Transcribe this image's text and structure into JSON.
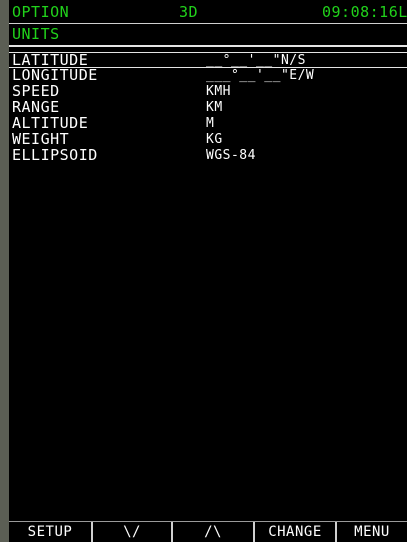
{
  "header": {
    "title": "OPTION",
    "mode": "3D",
    "time": "09:08:16L"
  },
  "page": {
    "title": "UNITS"
  },
  "rows": [
    {
      "label": "LATITUDE",
      "value": "__°__'__\"N/S"
    },
    {
      "label": "LONGITUDE",
      "value": "___°__'__\"E/W"
    },
    {
      "label": "SPEED",
      "value": "KMH"
    },
    {
      "label": "RANGE",
      "value": "KM"
    },
    {
      "label": "ALTITUDE",
      "value": "M"
    },
    {
      "label": "WEIGHT",
      "value": "KG"
    },
    {
      "label": "ELLIPSOID",
      "value": "WGS-84"
    }
  ],
  "softkeys": [
    {
      "label": "SETUP"
    },
    {
      "label": "\\/"
    },
    {
      "label": "/\\"
    },
    {
      "label": "CHANGE"
    },
    {
      "label": "MENU"
    }
  ],
  "colors": {
    "header_green": "#21d21b",
    "text": "#ffffff",
    "background": "#000000",
    "bezel": "#5b5e54"
  }
}
